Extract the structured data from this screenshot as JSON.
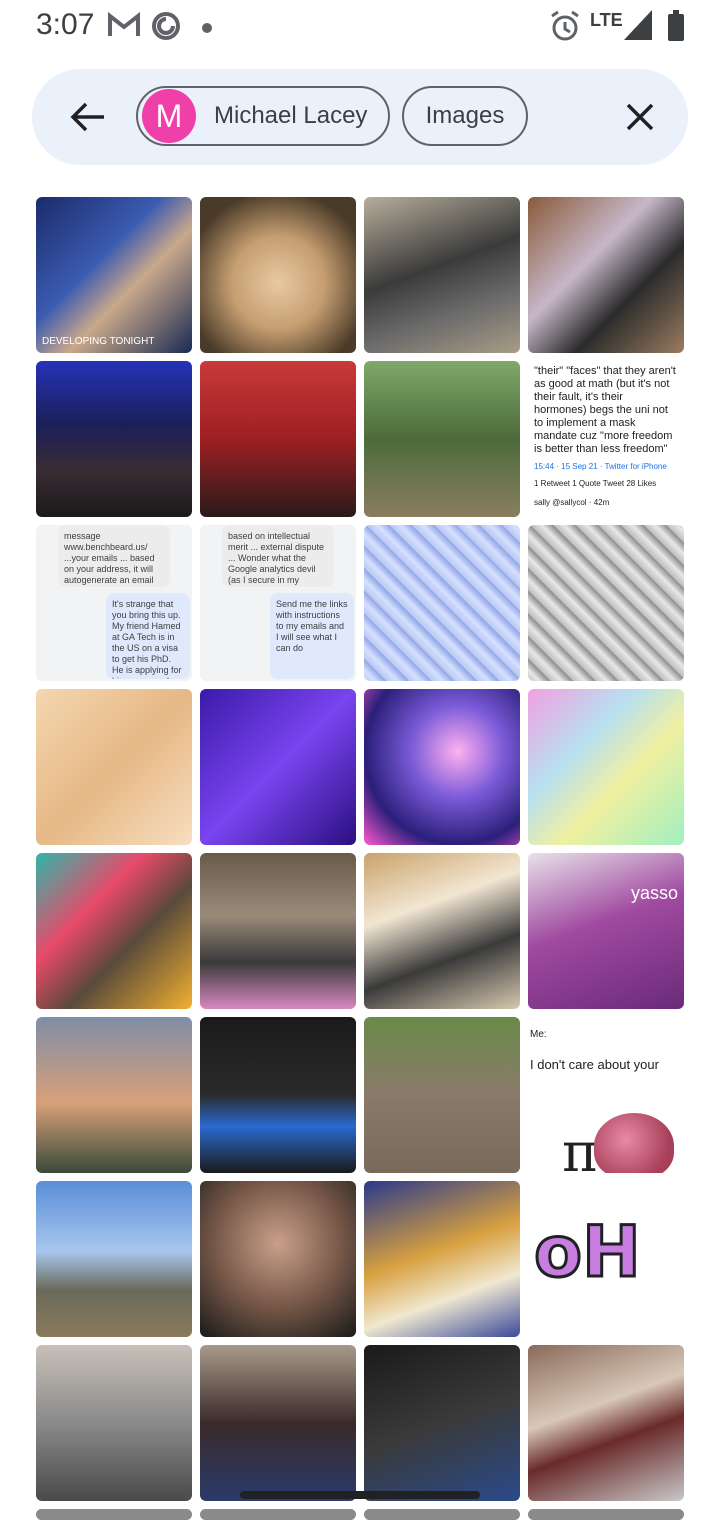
{
  "status_bar": {
    "time": "3:07",
    "network": "LTE",
    "icons": [
      "gmail-icon",
      "at-sign-icon",
      "dot-icon",
      "alarm-icon",
      "signal-icon",
      "battery-icon"
    ]
  },
  "search": {
    "chips": [
      {
        "avatar_letter": "M",
        "label": "Michael Lacey",
        "avatar_color": "#f03fa8"
      },
      {
        "label": "Images"
      }
    ]
  },
  "tiles": [
    {
      "kind": "photo",
      "desc": "news-broadcast",
      "bg": "linear-gradient(135deg,#1b2b6b 0%,#3b5bb0 40%,#c9a88a 60%,#1a2a55 100%)",
      "caption": "DEVELOPING TONIGHT"
    },
    {
      "kind": "photo",
      "desc": "cat",
      "bg": "radial-gradient(circle at 50% 55%,#e9c9a2 0%,#c59e71 40%,#4a3a28 80%)"
    },
    {
      "kind": "photo",
      "desc": "pet-tent",
      "bg": "linear-gradient(160deg,#b7ae9c 0%,#3b3b3b 45%,#6a6a6a 70%,#a89c86 100%)"
    },
    {
      "kind": "photo",
      "desc": "award-ceremony",
      "bg": "linear-gradient(135deg,#8a5a3a 0%,#c7b7c9 40%,#2b2b2b 65%,#9b7c60 100%)"
    },
    {
      "kind": "photo",
      "desc": "concert-crowd",
      "bg": "linear-gradient(180deg,#2533b8 0%,#1b1f5a 40%,#3a2c34 70%,#1a1a1a 100%)"
    },
    {
      "kind": "photo",
      "desc": "joe-joes-box",
      "bg": "linear-gradient(180deg,#c93a3a 0%,#9e1f22 50%,#2a1a1a 100%)"
    },
    {
      "kind": "photo",
      "desc": "forest-trail",
      "bg": "linear-gradient(180deg,#7fa86a 0%,#4c6b3a 50%,#8a7e60 100%)"
    },
    {
      "kind": "tweet",
      "text": "\"their\" \"faces\" that they aren't as good at math (but it's not their fault, it's their hormones) begs the uni not to implement a mask mandate cuz \"more freedom is better than less freedom\"",
      "meta": "15:44 · 15 Sep 21 · Twitter for iPhone",
      "stats": "1 Retweet  1 Quote Tweet  28 Likes",
      "handle": "sally @sallycol · 42m"
    },
    {
      "kind": "chat",
      "left_bubble": "message www.benchbeard.us/ ...your emails ... based on your address, it will autogenerate an email (the you can edit) based on your Senator's stance. Let me know when you hit a dumb!",
      "right_bubble": "It's strange that you bring this up. My friend Hamed at GA Tech is in the US on a visa to get his PhD. He is applying for his green card..."
    },
    {
      "kind": "chat",
      "left_bubble": "based on intellectual merit ... external dispute ... Wonder what the Google analytics devil (as I secure in my citizenship having been born in the US, say about that ...",
      "right_bubble": "Send me the links with instructions to my emails and I will see what I can do"
    },
    {
      "kind": "photo",
      "desc": "math-art-blue",
      "bg": "repeating-linear-gradient(45deg,#b9c8f2 0px,#d6e0ff 8px,#8ea6e6 16px)"
    },
    {
      "kind": "photo",
      "desc": "math-art-gray",
      "bg": "repeating-linear-gradient(45deg,#bdbdbd 0px,#e8e8e8 8px,#8a8a8a 16px)"
    },
    {
      "kind": "photo",
      "desc": "math-equations",
      "bg": "linear-gradient(135deg,#f4d7b0 0%,#e6b885 50%,#f7dec0 100%)"
    },
    {
      "kind": "photo",
      "desc": "purple-maze",
      "bg": "linear-gradient(135deg,#3a1aa8 0%,#7a44f0 50%,#2a1080 100%)"
    },
    {
      "kind": "photo",
      "desc": "cosmic-sigma",
      "bg": "radial-gradient(circle at 60% 40%,#ffb0f0 0%,#7b5bd8 35%,#2a1f7a 70%,#ff5ad0 100%)"
    },
    {
      "kind": "photo",
      "desc": "psychedelic",
      "bg": "linear-gradient(135deg,#f2a0e0 0%,#b8e0f0 35%,#f0f0a0 60%,#a0f0c0 100%)"
    },
    {
      "kind": "photo",
      "desc": "sombrero-cat",
      "bg": "linear-gradient(135deg,#2fb6a8 0%,#e84a6a 35%,#5a4a3a 60%,#f0b030 100%)"
    },
    {
      "kind": "photo",
      "desc": "utility-cart",
      "bg": "linear-gradient(180deg,#6a5a4a 0%,#9a8a7a 40%,#3a3a3a 70%,#d888c0 100%)"
    },
    {
      "kind": "photo",
      "desc": "woman-kitchen",
      "bg": "linear-gradient(160deg,#c9a26a 0%,#f2e6d2 35%,#3a3a3a 65%,#d7c8b0 100%)"
    },
    {
      "kind": "photo",
      "desc": "yasso-box",
      "bg": "linear-gradient(160deg,#e8e2ea 0%,#a04aa0 45%,#6a2a7a 100%)",
      "caption": "yasso"
    },
    {
      "kind": "photo",
      "desc": "wine-glass-sunset",
      "bg": "linear-gradient(180deg,#7f8ea6 0%,#d8a07a 55%,#3a4a3a 100%)"
    },
    {
      "kind": "photo",
      "desc": "sonic-mask",
      "bg": "linear-gradient(180deg,#1a1a1a 0%,#2a2a2a 50%,#2a6ad0 70%,#1a1a1a 100%)"
    },
    {
      "kind": "photo",
      "desc": "toddler-stones",
      "bg": "linear-gradient(180deg,#6a8a4a 0%,#8a7a6a 50%,#7a6a5a 100%)"
    },
    {
      "kind": "meme",
      "line1": "Me:",
      "line2": "I don't care about your",
      "pi": "π"
    },
    {
      "kind": "photo",
      "desc": "river-bridge",
      "bg": "linear-gradient(180deg,#5a8ed8 0%,#a8c6ee 45%,#6a6a5a 70%,#8a7a5a 100%)"
    },
    {
      "kind": "photo",
      "desc": "man-smiling",
      "bg": "radial-gradient(circle at 50% 40%,#c9a08a 0%,#7a5a4a 50%,#1a1a1a 100%)"
    },
    {
      "kind": "photo",
      "desc": "omelette-plate",
      "bg": "linear-gradient(160deg,#2a3a8a 0%,#d8a040 45%,#f0e8d0 70%,#3a4a9a 100%)"
    },
    {
      "kind": "photo",
      "desc": "oh-letters",
      "bg": "#ffffff",
      "overlay": "oH"
    },
    {
      "kind": "photo",
      "desc": "dog-bed",
      "bg": "linear-gradient(180deg,#c8c0b8 0%,#8a8a8a 50%,#4a4a4a 100%)"
    },
    {
      "kind": "photo",
      "desc": "selfie",
      "bg": "linear-gradient(180deg,#a89a8a 0%,#3a2a2a 50%,#2a3a6a 100%)"
    },
    {
      "kind": "photo",
      "desc": "black-tshirt",
      "bg": "linear-gradient(160deg,#1a1a1a 0%,#3a3a3a 50%,#2a4a8a 100%)"
    },
    {
      "kind": "photo",
      "desc": "food-foil",
      "bg": "linear-gradient(160deg,#8a6a5a 0%,#d8c8b8 40%,#6a2a2a 60%,#c8c8c8 100%)"
    }
  ]
}
